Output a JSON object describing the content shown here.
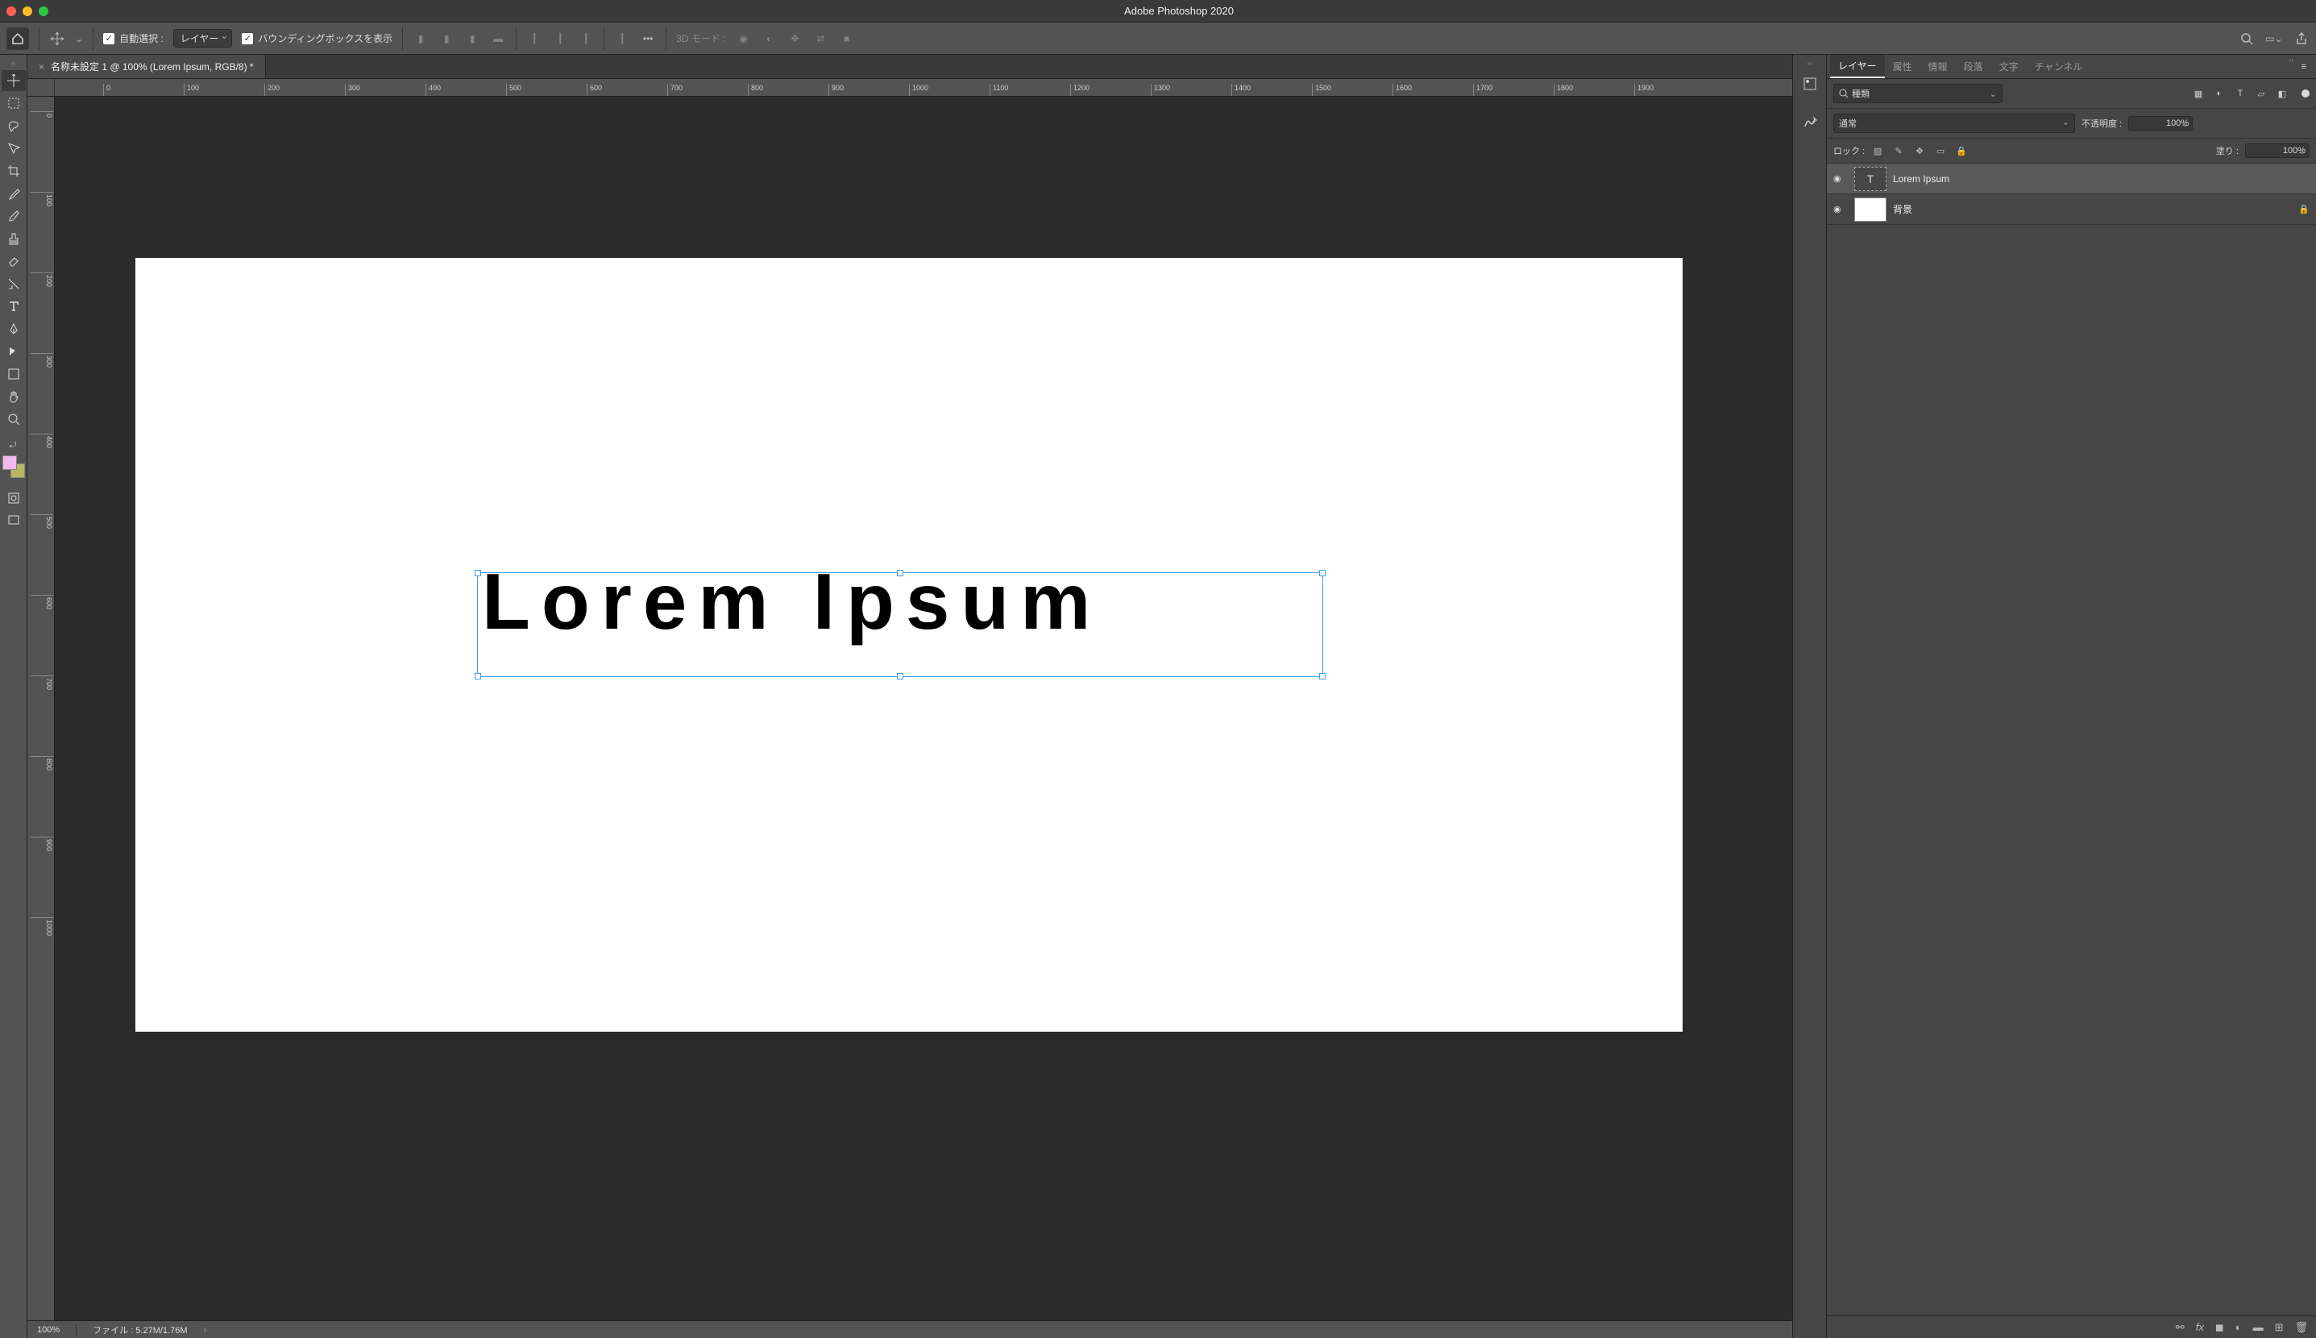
{
  "window": {
    "title": "Adobe Photoshop 2020"
  },
  "options_bar": {
    "auto_select_label": "自動選択 :",
    "auto_select_checked": true,
    "auto_select_target": "レイヤー",
    "bounding_box_label": "バウンディングボックスを表示",
    "bounding_box_checked": true,
    "mode_3d_label": "3D モード :"
  },
  "document": {
    "tab_title": "名称未設定 1 @ 100% (Lorem Ipsum, RGB/8) *",
    "zoom": "100%",
    "file_size": "ファイル : 5.27M/1.76M",
    "canvas_text": "Lorem Ipsum"
  },
  "ruler_h": [
    "0",
    "100",
    "200",
    "300",
    "400",
    "500",
    "600",
    "700",
    "800",
    "900",
    "1000",
    "1100",
    "1200",
    "1300",
    "1400",
    "1500",
    "1600",
    "1700",
    "1800",
    "1900"
  ],
  "ruler_v": [
    "0",
    "100",
    "200",
    "300",
    "400",
    "500",
    "600",
    "700",
    "800",
    "900",
    "1000"
  ],
  "panels": {
    "tabs": [
      "レイヤー",
      "属性",
      "情報",
      "段落",
      "文字",
      "チャンネル"
    ],
    "active_tab": 0,
    "filter_label": "種類",
    "blend_mode": "通常",
    "opacity_label": "不透明度 :",
    "opacity_value": "100%",
    "lock_label": "ロック :",
    "fill_label": "塗り :",
    "fill_value": "100%",
    "layers": [
      {
        "name": "Lorem Ipsum",
        "type": "text",
        "visible": true,
        "selected": true,
        "locked": false
      },
      {
        "name": "背景",
        "type": "pixel",
        "visible": true,
        "selected": false,
        "locked": true
      }
    ]
  },
  "tools": [
    "move",
    "marquee",
    "lasso",
    "wand",
    "crop",
    "eyedropper",
    "brush",
    "stamp",
    "eraser",
    "gradient",
    "blur",
    "type",
    "pen",
    "path",
    "shape",
    "hand",
    "zoom"
  ]
}
